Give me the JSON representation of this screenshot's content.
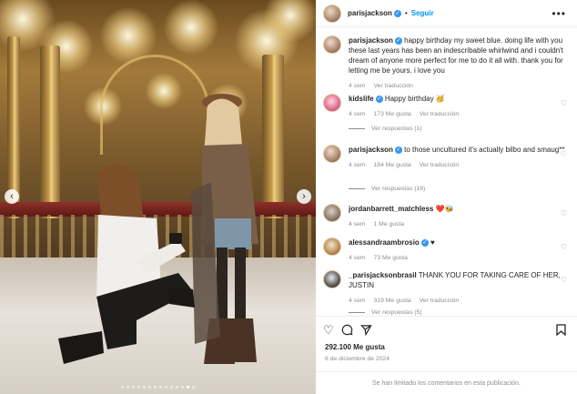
{
  "post": {
    "username": "parisjackson",
    "follow_label": "Seguir",
    "separator": "•",
    "more_icon": "more-horizontal-icon",
    "caption": "happy birthday my sweet blue. doing life with you these last years has been an indescribable whirlwind and i couldn't dream of anyone more perfect for me to do it all with. thank you for letting me be yours. i love you",
    "caption_time": "4 sem",
    "caption_translate": "Ver traducción",
    "likes": "292.100 Me gusta",
    "date": "6 de diciembre de 2024",
    "comments_limited": "Se han limitado los comentarios en esta publicación.",
    "carousel_total": 14,
    "carousel_active": 12
  },
  "comments": [
    {
      "username": "kidslife",
      "verified": true,
      "text": "Happy birthday 🥳",
      "time": "4 sem",
      "likes": "173 Me gusta",
      "translate": "Ver traducción",
      "replies": "Ver respuestas (1)"
    },
    {
      "username": "parisjackson",
      "verified": true,
      "text": "to those uncultured it's actually bilbo and smaug**",
      "time": "4 sem",
      "likes": "184 Me gusta",
      "translate": "Ver traducción",
      "replies": "Ver respuestas (16)"
    },
    {
      "username": "jordanbarrett_matchless",
      "verified": false,
      "text": "❤️🐝",
      "time": "4 sem",
      "likes": "1 Me gusta",
      "translate": "",
      "replies": ""
    },
    {
      "username": "alessandraambrosio",
      "verified": true,
      "text": "♥",
      "time": "4 sem",
      "likes": "73 Me gusta",
      "translate": "",
      "replies": ""
    },
    {
      "username": "_parisjacksonbrasil",
      "verified": false,
      "text": "THANK YOU FOR TAKING CARE OF HER, JUSTIN",
      "time": "4 sem",
      "likes": "319 Me gusta",
      "translate": "Ver traducción",
      "replies": "Ver respuestas (5)"
    }
  ],
  "icons": {
    "like": "heart-icon",
    "comment": "comment-icon",
    "share": "send-icon",
    "save": "bookmark-icon",
    "prev": "chevron-left-icon",
    "next": "chevron-right-icon",
    "expand": "expand-icon"
  },
  "colors": {
    "link_blue": "#0095f6",
    "verified_blue": "#3897f0",
    "muted": "#8e8e8e",
    "text": "#262626"
  }
}
